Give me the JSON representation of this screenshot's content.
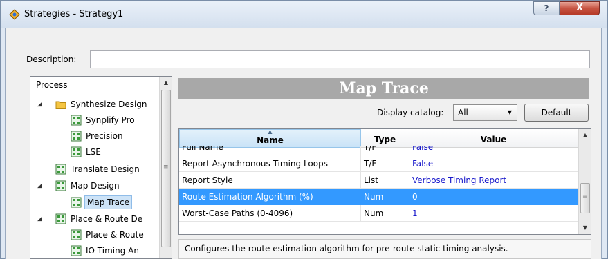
{
  "window": {
    "title": "Strategies - Strategy1",
    "help_glyph": "?",
    "close_glyph": "X"
  },
  "description": {
    "label": "Description:",
    "value": ""
  },
  "process_tree": {
    "header": "Process",
    "items": [
      {
        "label": "Synthesize Design",
        "icon": "folder-icon",
        "expanded": true
      },
      {
        "label": "Synplify Pro",
        "icon": "process-icon"
      },
      {
        "label": "Precision",
        "icon": "process-icon"
      },
      {
        "label": "LSE",
        "icon": "process-icon"
      },
      {
        "label": "Translate Design",
        "icon": "process-icon"
      },
      {
        "label": "Map Design",
        "icon": "process-icon",
        "expanded": true
      },
      {
        "label": "Map Trace",
        "icon": "process-icon",
        "selected": true
      },
      {
        "label": "Place & Route De",
        "icon": "process-icon",
        "expanded": true
      },
      {
        "label": "Place & Route",
        "icon": "process-icon"
      },
      {
        "label": "IO Timing An",
        "icon": "process-icon"
      }
    ]
  },
  "panel": {
    "banner": "Map Trace",
    "catalog_label": "Display catalog:",
    "catalog_value": "All",
    "default_button": "Default"
  },
  "grid": {
    "columns": [
      "Name",
      "Type",
      "Value"
    ],
    "rows": [
      {
        "name": "Full Name",
        "type": "T/F",
        "value": "False"
      },
      {
        "name": "Report Asynchronous Timing Loops",
        "type": "T/F",
        "value": "False"
      },
      {
        "name": "Report Style",
        "type": "List",
        "value": "Verbose Timing Report"
      },
      {
        "name": "Route Estimation Algorithm (%)",
        "type": "Num",
        "value": "0",
        "selected": true
      },
      {
        "name": "Worst-Case Paths (0-4096)",
        "type": "Num",
        "value": "1"
      }
    ]
  },
  "help_text": "Configures the route estimation algorithm for pre-route static timing analysis.",
  "colors": {
    "selection": "#3399ff",
    "value_text": "#1a1acb",
    "banner_bg": "#a8a8a8"
  }
}
